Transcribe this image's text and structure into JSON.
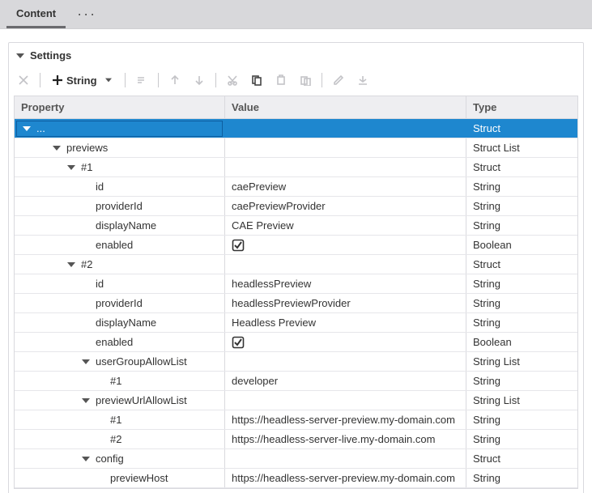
{
  "tabs": {
    "content": "Content"
  },
  "panel": {
    "title": "Settings"
  },
  "toolbar": {
    "add_label": "String"
  },
  "columns": {
    "property": "Property",
    "value": "Value",
    "type": "Type"
  },
  "rows": [
    {
      "indent": 0,
      "expander": "down",
      "property": "...",
      "value": "",
      "type": "Struct",
      "selected": true
    },
    {
      "indent": 1,
      "expander": "down",
      "property": "previews",
      "value": "",
      "type": "Struct List"
    },
    {
      "indent": 2,
      "expander": "down",
      "property": "#1",
      "value": "",
      "type": "Struct"
    },
    {
      "indent": 3,
      "expander": "none",
      "property": "id",
      "value": "caePreview",
      "type": "String"
    },
    {
      "indent": 3,
      "expander": "none",
      "property": "providerId",
      "value": "caePreviewProvider",
      "type": "String"
    },
    {
      "indent": 3,
      "expander": "none",
      "property": "displayName",
      "value": "CAE Preview",
      "type": "String"
    },
    {
      "indent": 3,
      "expander": "none",
      "property": "enabled",
      "value_kind": "check",
      "value": "",
      "type": "Boolean"
    },
    {
      "indent": 2,
      "expander": "down",
      "property": "#2",
      "value": "",
      "type": "Struct"
    },
    {
      "indent": 3,
      "expander": "none",
      "property": "id",
      "value": "headlessPreview",
      "type": "String"
    },
    {
      "indent": 3,
      "expander": "none",
      "property": "providerId",
      "value": "headlessPreviewProvider",
      "type": "String"
    },
    {
      "indent": 3,
      "expander": "none",
      "property": "displayName",
      "value": "Headless Preview",
      "type": "String"
    },
    {
      "indent": 3,
      "expander": "none",
      "property": "enabled",
      "value_kind": "check",
      "value": "",
      "type": "Boolean"
    },
    {
      "indent": 3,
      "expander": "down",
      "property": "userGroupAllowList",
      "value": "",
      "type": "String List"
    },
    {
      "indent": 4,
      "expander": "none",
      "property": "#1",
      "value": "developer",
      "type": "String"
    },
    {
      "indent": 3,
      "expander": "down",
      "property": "previewUrlAllowList",
      "value": "",
      "type": "String List"
    },
    {
      "indent": 4,
      "expander": "none",
      "property": "#1",
      "value": "https://headless-server-preview.my-domain.com",
      "type": "String"
    },
    {
      "indent": 4,
      "expander": "none",
      "property": "#2",
      "value": "https://headless-server-live.my-domain.com",
      "type": "String"
    },
    {
      "indent": 3,
      "expander": "down",
      "property": "config",
      "value": "",
      "type": "Struct"
    },
    {
      "indent": 4,
      "expander": "none",
      "property": "previewHost",
      "value": "https://headless-server-preview.my-domain.com",
      "type": "String"
    }
  ]
}
